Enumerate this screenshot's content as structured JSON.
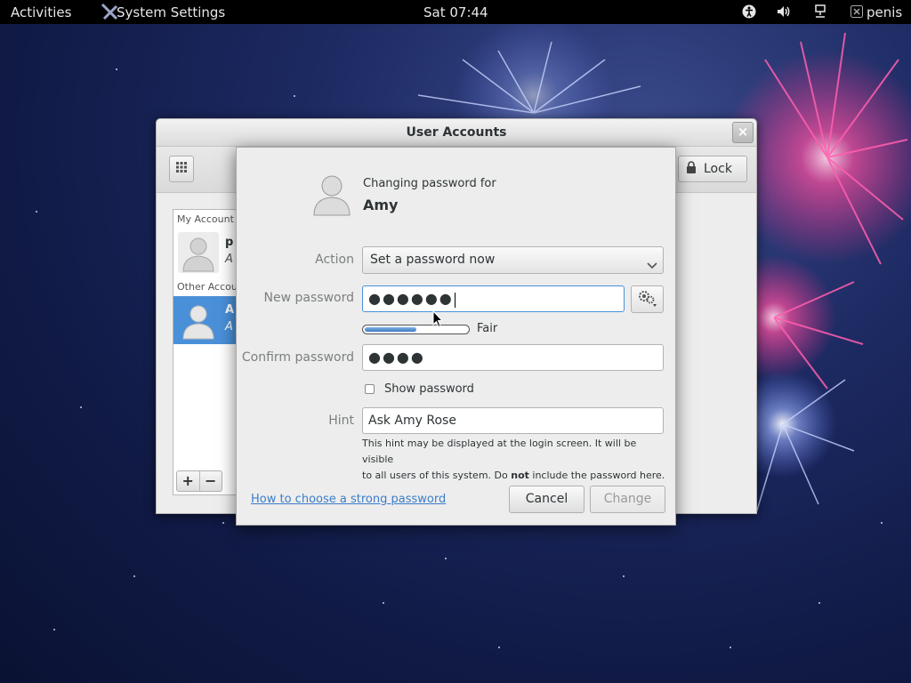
{
  "topbar": {
    "activities": "Activities",
    "app_name": "System Settings",
    "clock": "Sat 07:44",
    "user": "penis",
    "icons": [
      "accessibility-icon",
      "volume-icon",
      "network-icon",
      "user-status-icon"
    ]
  },
  "settings_window": {
    "title": "User Accounts",
    "close_label": "×",
    "lock_label": "Lock",
    "my_account_header": "My Account",
    "other_accounts_header": "Other Accou",
    "my_account_name": "p",
    "my_account_sub": "A",
    "selected_account_name": "A",
    "selected_account_sub": "A",
    "add_label": "+",
    "remove_label": "−"
  },
  "dialog": {
    "changing_for": "Changing password for",
    "username": "Amy",
    "action_label": "Action",
    "action_value": "Set a password now",
    "new_password_label": "New password",
    "new_password_value": "●●●●●●",
    "strength_fraction": 0.5,
    "strength_text": "Fair",
    "confirm_label": "Confirm password",
    "confirm_value": "●●●●",
    "show_password_label": "Show password",
    "show_password_checked": false,
    "hint_label": "Hint",
    "hint_value": "Ask Amy Rose",
    "hint_help_1": "This hint may be displayed at the login screen.  It will be visible",
    "hint_help_2a": "to all users of this system.  Do ",
    "hint_help_bold": "not",
    "hint_help_2b": " include the password here.",
    "help_link": "How to choose a strong password",
    "cancel_label": "Cancel",
    "change_label": "Change"
  },
  "colors": {
    "accent": "#4a90d9",
    "link": "#3b7dc9",
    "topbar": "#000000"
  }
}
